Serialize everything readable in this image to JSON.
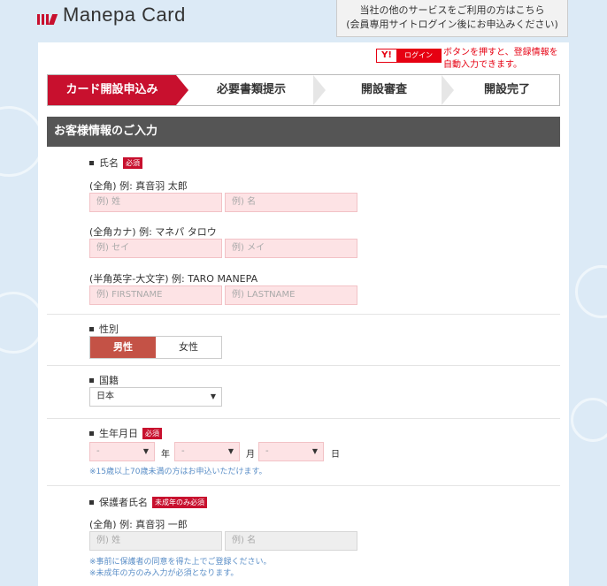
{
  "header": {
    "logo_text": "Manepa Card",
    "other_service_line1": "当社の他のサービスをご利用の方はこちら",
    "other_service_line2": "(会員専用サイトログイン後にお申込みください)"
  },
  "yahoo": {
    "logo": "Y!",
    "button_label": "ログイン",
    "note_line1": "ボタンを押すと、登録情報を",
    "note_line2": "自動入力できます。"
  },
  "steps": [
    {
      "label": "カード開設申込み",
      "active": true
    },
    {
      "label": "必要書類提示",
      "active": false
    },
    {
      "label": "開設審査",
      "active": false
    },
    {
      "label": "開設完了",
      "active": false
    }
  ],
  "section_title": "お客様情報のご入力",
  "name": {
    "label": "氏名",
    "required": "必須",
    "kanji_hint": "(全角) 例: 真音羽 太郎",
    "kanji_last_placeholder": "例) 姓",
    "kanji_first_placeholder": "例) 名",
    "kana_hint": "(全角カナ) 例: マネパ タロウ",
    "kana_last_placeholder": "例) セイ",
    "kana_first_placeholder": "例) メイ",
    "roman_hint": "(半角英字-大文字) 例: TARO MANEPA",
    "roman_last_placeholder": "例) FIRSTNAME",
    "roman_first_placeholder": "例) LASTNAME"
  },
  "gender": {
    "label": "性別",
    "male": "男性",
    "female": "女性",
    "selected": "男性"
  },
  "nationality": {
    "label": "国籍",
    "value": "日本"
  },
  "birthdate": {
    "label": "生年月日",
    "required": "必須",
    "year_value": "-",
    "month_value": "-",
    "day_value": "-",
    "year_unit": "年",
    "month_unit": "月",
    "day_unit": "日",
    "note": "※15歳以上70歳未満の方はお申込いただけます。"
  },
  "guardian": {
    "label": "保護者氏名",
    "required": "未成年のみ必須",
    "hint": "(全角) 例: 真音羽 一郎",
    "last_placeholder": "例) 姓",
    "first_placeholder": "例) 名",
    "note1": "※事前に保護者の同意を得た上でご登録ください。",
    "note2": "※未成年の方のみ入力が必須となります。"
  },
  "colors": {
    "brand_red": "#c8102e",
    "input_pink": "#fde3e5",
    "section_bar": "#555555",
    "background": "#dceaf6",
    "note_blue": "#5a8ec7"
  }
}
